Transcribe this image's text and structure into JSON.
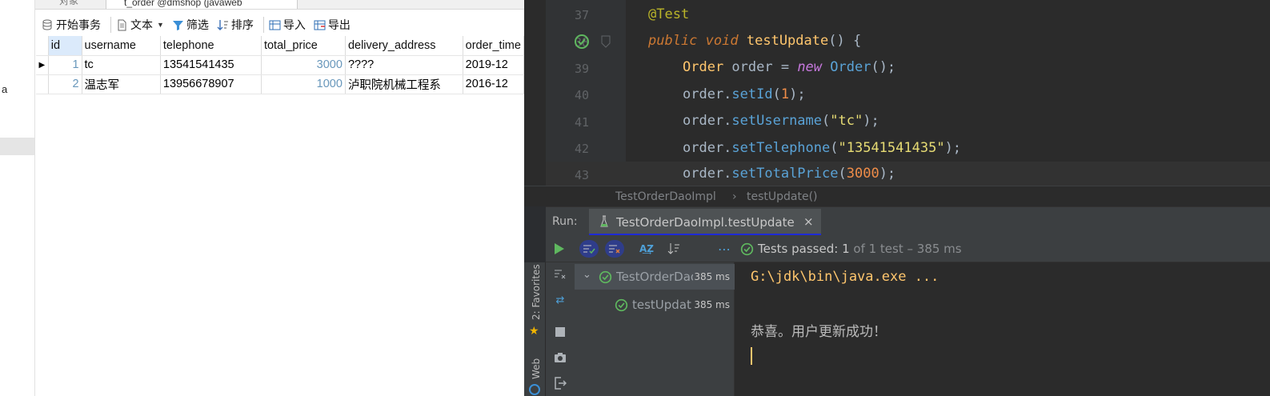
{
  "left_strip": {
    "text_fragment": "a"
  },
  "db": {
    "tabs": {
      "tab1": "对象",
      "tab2": "t_order @dmshop (javaweb"
    },
    "toolbar": {
      "begin_tx": "开始事务",
      "text": "文本",
      "filter": "筛选",
      "sort": "排序",
      "import": "导入",
      "export": "导出"
    },
    "columns": [
      "id",
      "username",
      "telephone",
      "total_price",
      "delivery_address",
      "order_time"
    ],
    "rows": [
      {
        "id": "1",
        "username": "tc",
        "telephone": "13541541435",
        "total_price": "3000",
        "delivery_address": "????",
        "order_time": "2019-12"
      },
      {
        "id": "2",
        "username": "温志军",
        "telephone": "13956678907",
        "total_price": "1000",
        "delivery_address": "泸职院机械工程系",
        "order_time": "2016-12"
      }
    ]
  },
  "ide": {
    "lines": [
      {
        "n": "37"
      },
      {
        "n": "38"
      },
      {
        "n": "39"
      },
      {
        "n": "40"
      },
      {
        "n": "41"
      },
      {
        "n": "42"
      },
      {
        "n": "43"
      }
    ],
    "code": {
      "l37": "@Test",
      "l38_kw1": "public",
      "l38_kw2": "void",
      "l38_fn": "testUpdate",
      "l38_rest": "() {",
      "l39_type": "Order",
      "l39_var": " order = ",
      "l39_new": "new",
      "l39_ctor": " Order",
      "l39_end": "();",
      "l40_obj": "order.",
      "l40_m": "setId",
      "l40_a": "(",
      "l40_num": "1",
      "l40_end": ");",
      "l41_obj": "order.",
      "l41_m": "setUsername",
      "l41_a": "(",
      "l41_str": "\"tc\"",
      "l41_end": ");",
      "l42_obj": "order.",
      "l42_m": "setTelephone",
      "l42_a": "(",
      "l42_str": "\"13541541435\"",
      "l42_end": ");",
      "l43_obj": "order.",
      "l43_m": "setTotalPrice",
      "l43_a": "(",
      "l43_num": "3000",
      "l43_end": ");"
    },
    "breadcrumb": {
      "cls": "TestOrderDaoImpl",
      "sep": "›",
      "method": "testUpdate()"
    },
    "run": {
      "label": "Run:",
      "tab": "TestOrderDaoImpl.testUpdate",
      "close": "×",
      "tests_passed": "Tests passed:",
      "count": "1",
      "detail": "of 1 test – 385 ms"
    },
    "side": {
      "favorites": "2: Favorites",
      "web": "Web"
    },
    "tree": [
      {
        "label": "TestOrderDao",
        "ms": "385 ms"
      },
      {
        "label": "testUpdat",
        "ms": "385 ms"
      }
    ],
    "console": {
      "cmd": "G:\\jdk\\bin\\java.exe ...",
      "msg": "恭喜。用户更新成功！"
    }
  },
  "colors": {
    "accent_run_tab": "#1e2ad6",
    "passed_green": "#5fb85f",
    "console_yellow": "#ffc66d"
  }
}
